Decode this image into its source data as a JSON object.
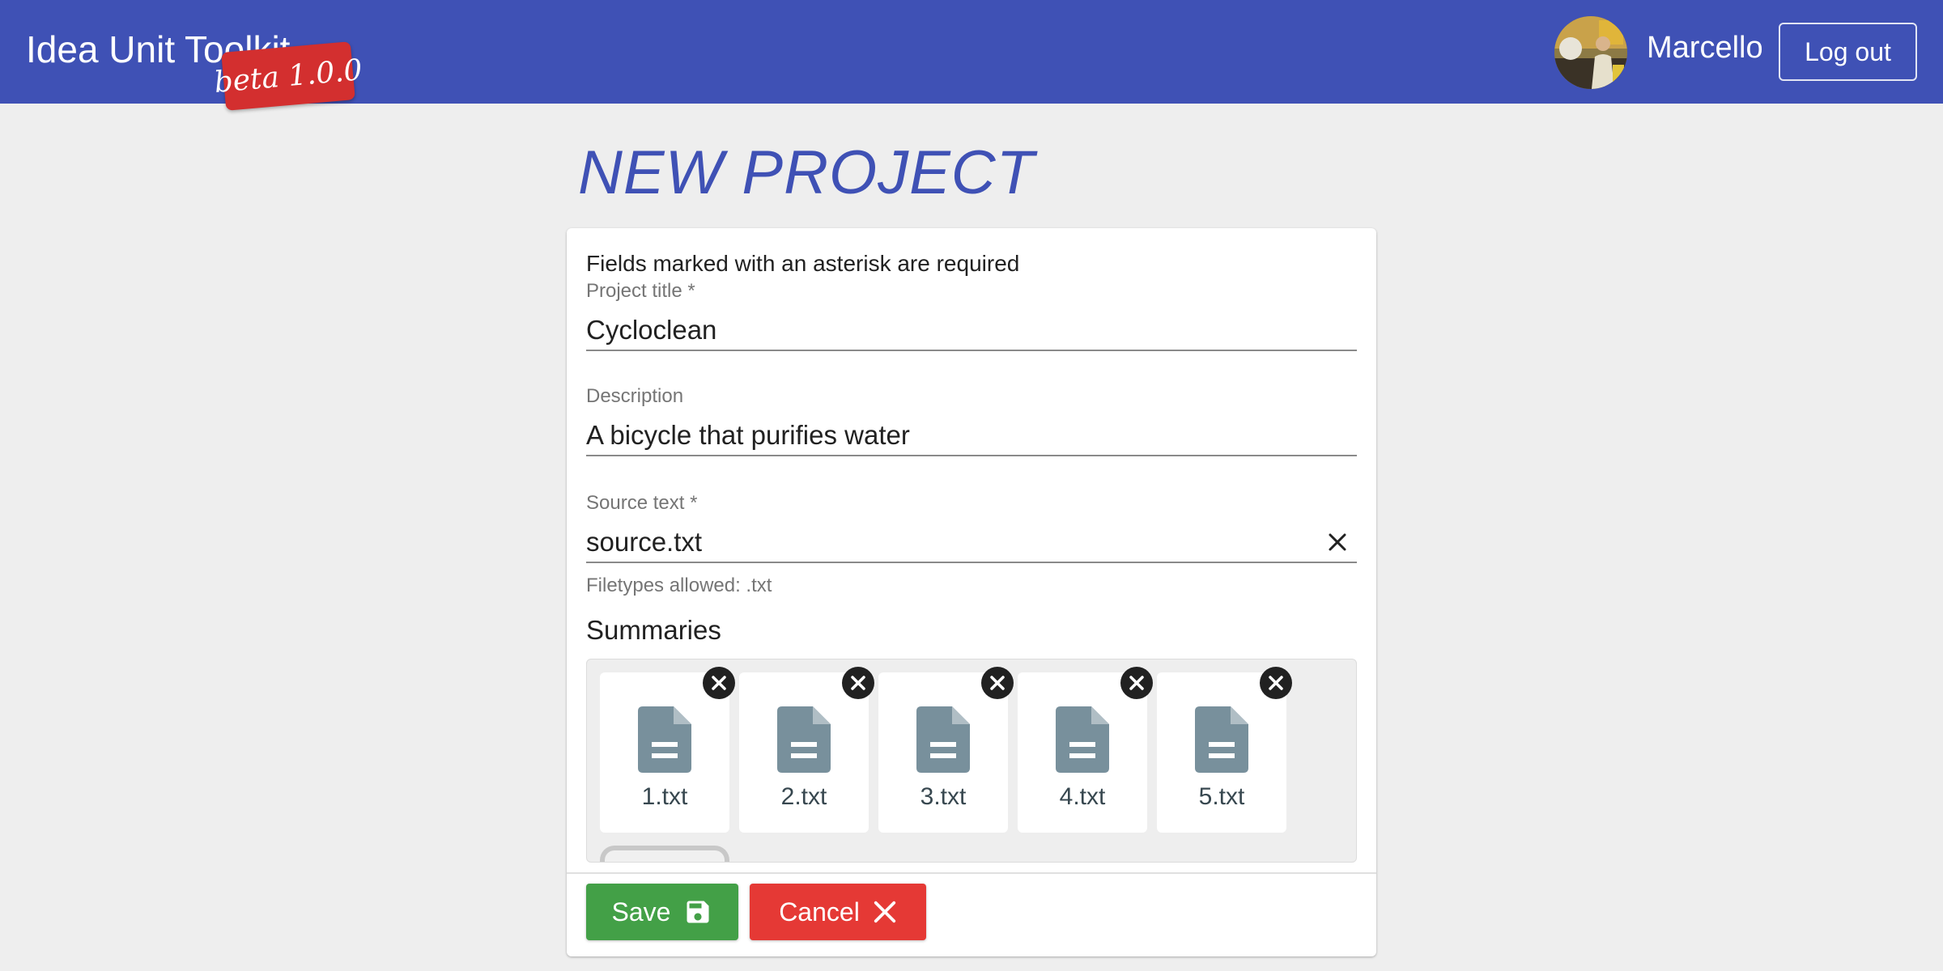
{
  "header": {
    "app_title": "Idea Unit Toolkit",
    "beta_badge": "beta 1.0.0",
    "username": "Marcello",
    "logout_label": "Log out",
    "color": "#3f51b5"
  },
  "page": {
    "title": "NEW PROJECT"
  },
  "form": {
    "required_note": "Fields marked with an asterisk are required",
    "project_title": {
      "label": "Project title *",
      "value": "Cycloclean"
    },
    "description": {
      "label": "Description",
      "value": "A bicycle that purifies water"
    },
    "source_text": {
      "label": "Source text *",
      "value": "source.txt",
      "hint": "Filetypes allowed: .txt",
      "clear_icon": "close-icon"
    },
    "summaries": {
      "label": "Summaries",
      "file_icon": "document-icon",
      "remove_icon": "remove-circle-icon",
      "files": [
        {
          "name": "1.txt"
        },
        {
          "name": "2.txt"
        },
        {
          "name": "3.txt"
        },
        {
          "name": "4.txt"
        },
        {
          "name": "5.txt"
        }
      ]
    },
    "buttons": {
      "save_label": "Save",
      "save_icon": "floppy-disk-icon",
      "save_color": "#43a047",
      "cancel_label": "Cancel",
      "cancel_icon": "close-icon",
      "cancel_color": "#e53935"
    }
  }
}
